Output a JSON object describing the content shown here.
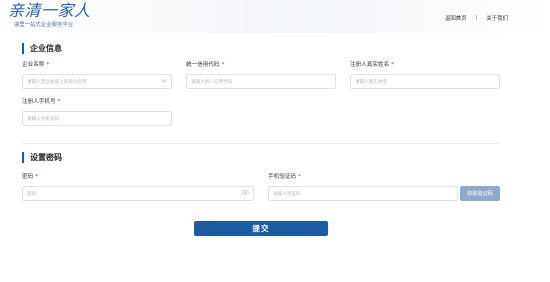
{
  "header": {
    "logo_title": "亲清一家人",
    "logo_subtitle": "湖里一站式企业服务平台",
    "nav": {
      "home": "返回首页",
      "separator": "|",
      "about": "关于我们"
    }
  },
  "sections": {
    "enterprise": {
      "title": "企业信息",
      "company_name": {
        "label": "企业名称",
        "required": "*",
        "placeholder": "请输入营业执照上的单位名称",
        "icon": "chevron-down-icon"
      },
      "credit_code": {
        "label": "统一信用代码",
        "required": "*",
        "placeholder": "请输入统一信用代码"
      },
      "real_name": {
        "label": "注册人真实姓名",
        "required": "*",
        "placeholder": "请输入真实姓名"
      },
      "phone": {
        "label": "注册人手机号",
        "required": "*",
        "placeholder": "请输入手机号码"
      }
    },
    "password": {
      "title": "设置密码",
      "password": {
        "label": "密码",
        "required": "*",
        "placeholder": "密码",
        "icon": "eye-icon"
      },
      "sms_code": {
        "label": "手机验证码",
        "required": "*",
        "placeholder": "请输入验证码"
      },
      "get_code_button": "获取验证码"
    }
  },
  "submit_button": "提交",
  "colors": {
    "primary": "#1f5ba3",
    "disabled_button": "#8fa9cc",
    "required": "#e1251b"
  }
}
